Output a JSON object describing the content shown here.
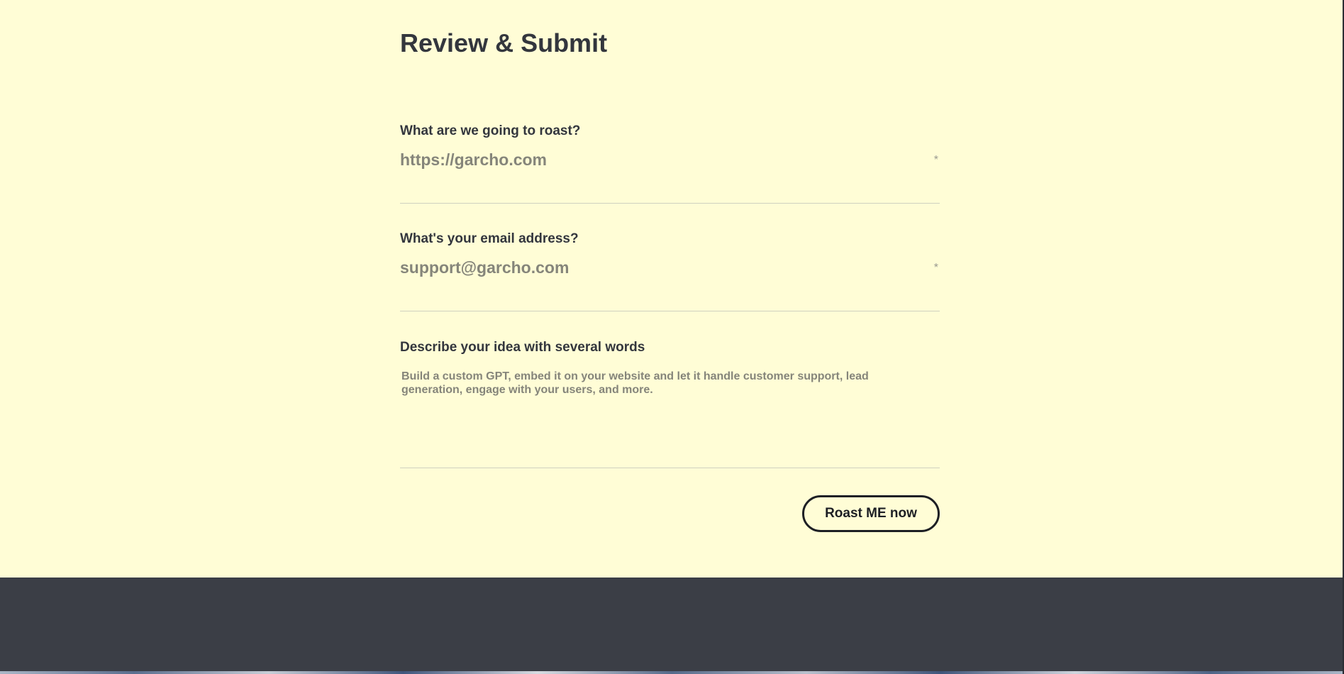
{
  "form": {
    "title": "Review & Submit",
    "fields": [
      {
        "label": "What are we going to roast?",
        "placeholder": "https://garcho.com",
        "required_icon": "*"
      },
      {
        "label": "What's your email address?",
        "placeholder": "support@garcho.com",
        "required_icon": "*"
      },
      {
        "label": "Describe your idea with several words",
        "placeholder": "Build a custom GPT, embed it on your website and let it handle customer support, lead generation, engage with your users, and more."
      }
    ],
    "submit_label": "Roast ME now"
  },
  "colors": {
    "page_background": "#fffdd6",
    "text_dark": "#33363d",
    "placeholder_gray": "#85857a",
    "footer_background": "#3b3e46"
  }
}
